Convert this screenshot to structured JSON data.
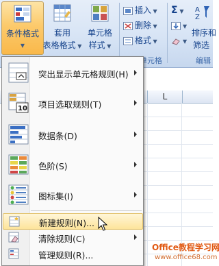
{
  "ribbon": {
    "conditional_format": "条件格式",
    "table_format_line1": "套用",
    "table_format_line2": "表格格式",
    "cell_style_line1": "单元格",
    "cell_style_line2": "样式",
    "insert": "插入",
    "delete": "删除",
    "format": "格式",
    "sort_line1": "排序和",
    "sort_line2": "筛选",
    "group_cells": "单元格",
    "group_edit": "编辑",
    "sigma": "Σ"
  },
  "sheet": {
    "column_label": "L"
  },
  "menu": {
    "items": [
      {
        "label": "突出显示单元格规则(H)"
      },
      {
        "label": "项目选取规则(T)"
      },
      {
        "label": "数据条(D)"
      },
      {
        "label": "色阶(S)"
      },
      {
        "label": "图标集(I)"
      }
    ],
    "commands": [
      {
        "label": "新建规则(N)..."
      },
      {
        "label": "清除规则(C)"
      },
      {
        "label": "管理规则(R)..."
      }
    ],
    "top10_text": "10"
  },
  "watermark": {
    "line1": "Office教程学习网",
    "line2": "www.office68.com"
  }
}
